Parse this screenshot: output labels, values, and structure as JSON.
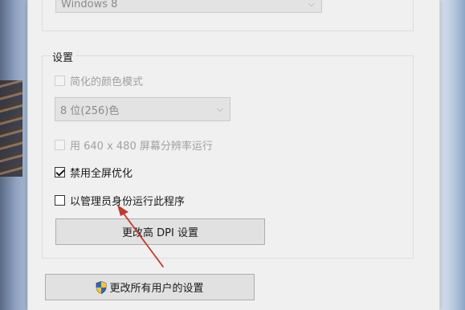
{
  "compatibility": {
    "os_select": {
      "value": "Windows 8"
    }
  },
  "settings": {
    "group_label": "设置",
    "reduced_color": {
      "label": "简化的颜色模式",
      "checked": false,
      "enabled": false
    },
    "color_depth_select": {
      "value": "8 位(256)色",
      "enabled": false
    },
    "low_res": {
      "label": "用 640 x 480 屏幕分辨率运行",
      "checked": false,
      "enabled": false
    },
    "disable_fullscreen_opt": {
      "label": "禁用全屏优化",
      "checked": true,
      "enabled": true
    },
    "run_as_admin": {
      "label": "以管理员身份运行此程序",
      "checked": false,
      "enabled": true
    },
    "dpi_button": {
      "label": "更改高 DPI 设置"
    }
  },
  "all_users_button": {
    "label": "更改所有用户的设置",
    "icon": "uac-shield-icon"
  },
  "annotation": {
    "icon": "red-pointer-arrow-icon",
    "color": "#c0392b"
  }
}
